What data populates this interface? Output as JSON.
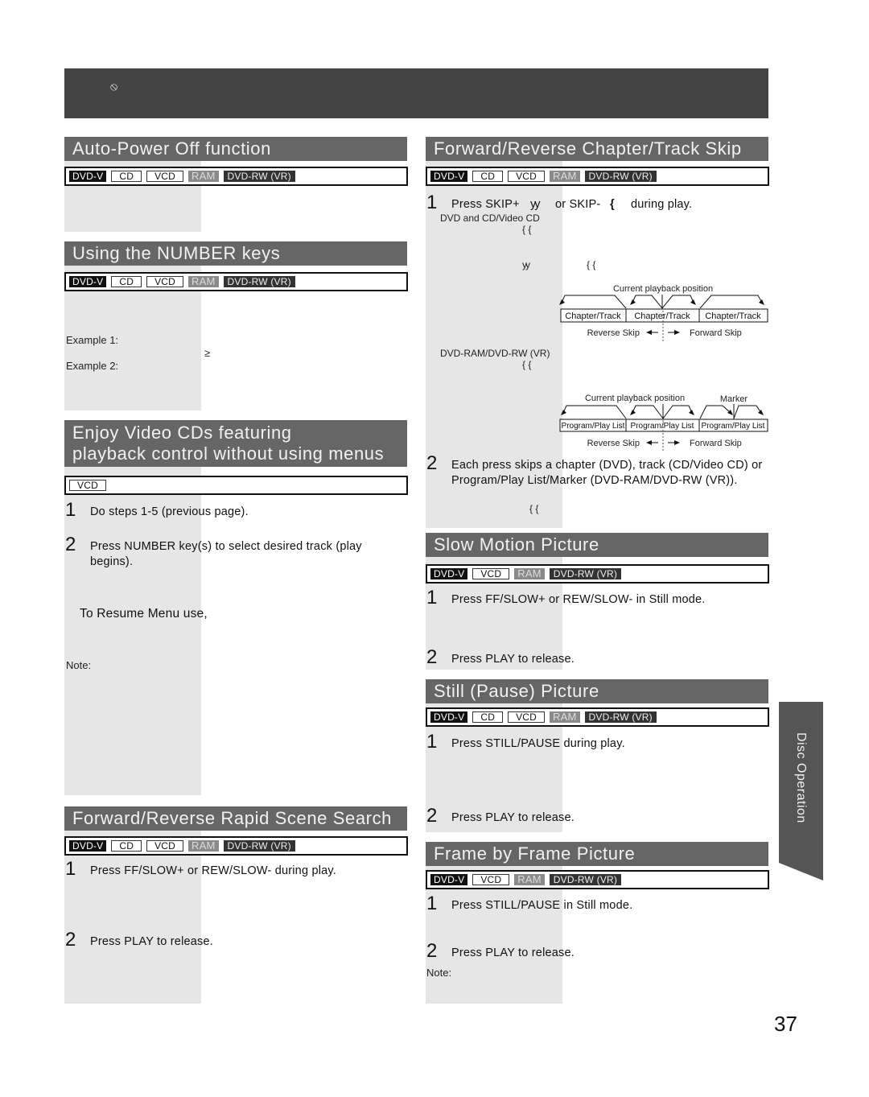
{
  "page": {
    "number": "37",
    "side_tab": "Disc Operation"
  },
  "top_banner": {
    "icon": "prohibited-icon",
    "icon_glyph": "⦸"
  },
  "badges": {
    "dvdv": "DVD-V",
    "cd": "CD",
    "vcd": "VCD",
    "ram": "RAM",
    "dvdrw": "DVD-RW (VR)"
  },
  "sections": {
    "auto_power": {
      "title": "Auto-Power Off function"
    },
    "number_keys": {
      "title": "Using the NUMBER keys",
      "example1": "Example 1:",
      "example2": "Example 2:",
      "symbol": "≥"
    },
    "vcd_pbc": {
      "title_line1": "Enjoy Video CDs featuring",
      "title_line2": "playback control without using menus",
      "steps": [
        {
          "num": "1",
          "text": "Do steps 1-5 (previous page)."
        },
        {
          "num": "2",
          "text": "Press NUMBER key(s) to select desired track (play begins)."
        }
      ],
      "resume": "To Resume Menu use,",
      "note": "Note:"
    },
    "rapid_search": {
      "title": "Forward/Reverse Rapid Scene Search",
      "steps": [
        {
          "num": "1",
          "text": "Press FF/SLOW+ or REW/SLOW- during play."
        },
        {
          "num": "2",
          "text": "Press PLAY to release."
        }
      ]
    },
    "chapter_skip": {
      "title": "Forward/Reverse Chapter/Track Skip",
      "step1": {
        "num": "1",
        "text_a": "Press SKIP+",
        "glyph_fwd": "yy",
        "text_b": "or SKIP-",
        "glyph_rev": "{",
        "text_c": "during play."
      },
      "sub_dvd_cd": "DVD and CD/Video CD",
      "brace_glyph": "{ {",
      "y_glyph": "yy",
      "diagram1": {
        "caption": "Current playback position",
        "cells": [
          "Chapter/Track",
          "Chapter/Track",
          "Chapter/Track"
        ],
        "reverse": "Reverse Skip",
        "forward": "Forward Skip"
      },
      "sub_ram": "DVD-RAM/DVD-RW (VR)",
      "diagram2": {
        "caption": "Current playback position",
        "marker": "Marker",
        "cells": [
          "Program/Play List",
          "Program/Play List",
          "Program/Play List"
        ],
        "reverse": "Reverse Skip",
        "forward": "Forward Skip"
      },
      "step2": {
        "num": "2",
        "text": "Each press skips a chapter (DVD), track (CD/Video CD) or Program/Play List/Marker (DVD-RAM/DVD-RW (VR))."
      }
    },
    "slow_motion": {
      "title": "Slow Motion Picture",
      "steps": [
        {
          "num": "1",
          "text": "Press FF/SLOW+ or REW/SLOW- in Still mode."
        },
        {
          "num": "2",
          "text": "Press PLAY to release."
        }
      ]
    },
    "still": {
      "title": "Still (Pause) Picture",
      "steps": [
        {
          "num": "1",
          "text": "Press STILL/PAUSE during play."
        },
        {
          "num": "2",
          "text": "Press PLAY to release."
        }
      ]
    },
    "frame": {
      "title": "Frame by Frame Picture",
      "steps": [
        {
          "num": "1",
          "text": "Press STILL/PAUSE in Still mode."
        },
        {
          "num": "2",
          "text": "Press PLAY to release."
        }
      ],
      "note": "Note:"
    }
  }
}
